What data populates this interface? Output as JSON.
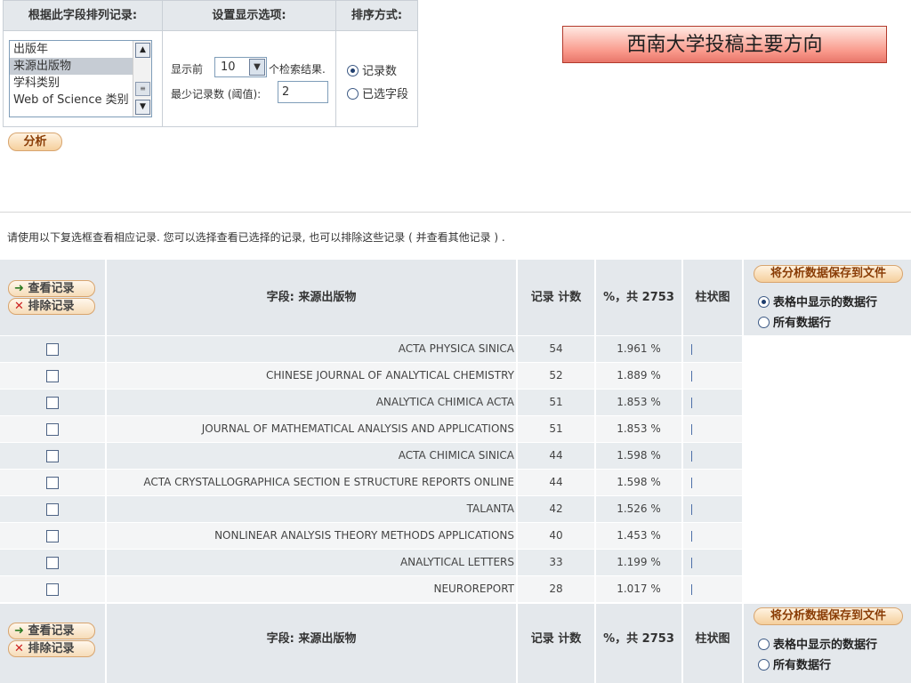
{
  "options_panel": {
    "sort_field_header": "根据此字段排列记录:",
    "display_header": "设置显示选项:",
    "sort_order_header": "排序方式:",
    "field_list": [
      {
        "label": "出版年",
        "selected": false
      },
      {
        "label": "来源出版物",
        "selected": true
      },
      {
        "label": "学科类别",
        "selected": false
      },
      {
        "label": "Web of Science 类别",
        "selected": false
      }
    ],
    "show_prefix": "显示前",
    "show_count": "10",
    "show_suffix": "个检索结果.",
    "min_records_label": "最少记录数 (阈值):",
    "min_records_value": "2",
    "sort_options": [
      {
        "label": "记录数",
        "selected": true
      },
      {
        "label": "已选字段",
        "selected": false
      }
    ],
    "analyze_button": "分析"
  },
  "title_banner": "西南大学投稿主要方向",
  "instructions": "请使用以下复选框查看相应记录. 您可以选择查看已选择的记录, 也可以排除这些记录 ( 并查看其他记录 ) .",
  "table": {
    "view_records_button": "查看记录",
    "exclude_records_button": "排除记录",
    "field_header": "字段: 来源出版物",
    "count_header": "记录 计数",
    "percent_header": "%，共 2753",
    "bar_header": "柱状图",
    "save_button": "将分析数据保存到文件",
    "save_options": [
      {
        "label": "表格中显示的数据行",
        "selected_top": true,
        "selected_bottom": false
      },
      {
        "label": "所有数据行",
        "selected_top": false,
        "selected_bottom": false
      }
    ],
    "rows": [
      {
        "name": "ACTA PHYSICA SINICA",
        "count": "54",
        "percent": "1.961 %",
        "bar": "I"
      },
      {
        "name": "CHINESE JOURNAL OF ANALYTICAL CHEMISTRY",
        "count": "52",
        "percent": "1.889 %",
        "bar": "I"
      },
      {
        "name": "ANALYTICA CHIMICA ACTA",
        "count": "51",
        "percent": "1.853 %",
        "bar": "I"
      },
      {
        "name": "JOURNAL OF MATHEMATICAL ANALYSIS AND APPLICATIONS",
        "count": "51",
        "percent": "1.853 %",
        "bar": "I"
      },
      {
        "name": "ACTA CHIMICA SINICA",
        "count": "44",
        "percent": "1.598 %",
        "bar": "I"
      },
      {
        "name": "ACTA CRYSTALLOGRAPHICA SECTION E STRUCTURE REPORTS ONLINE",
        "count": "44",
        "percent": "1.598 %",
        "bar": "I"
      },
      {
        "name": "TALANTA",
        "count": "42",
        "percent": "1.526 %",
        "bar": "I"
      },
      {
        "name": "NONLINEAR ANALYSIS THEORY METHODS APPLICATIONS",
        "count": "40",
        "percent": "1.453 %",
        "bar": "I"
      },
      {
        "name": "ANALYTICAL LETTERS",
        "count": "33",
        "percent": "1.199 %",
        "bar": "I"
      },
      {
        "name": "NEUROREPORT",
        "count": "28",
        "percent": "1.017 %",
        "bar": "I"
      }
    ]
  }
}
